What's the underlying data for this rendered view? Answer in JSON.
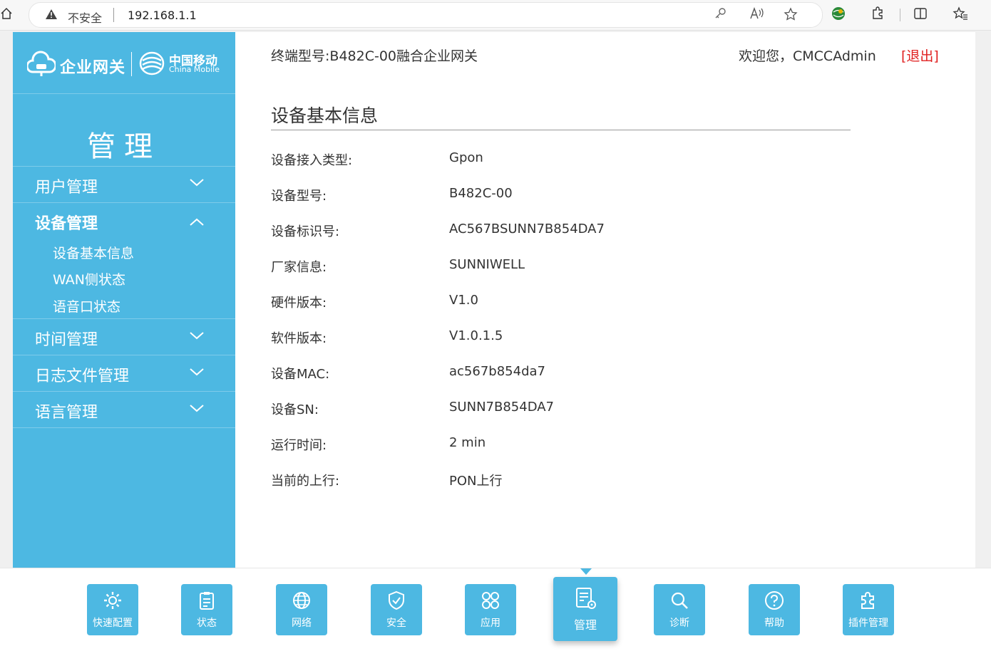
{
  "browser": {
    "insecure_label": "不安全",
    "url": "192.168.1.1"
  },
  "sidebar": {
    "logo_text": "企业网关",
    "brand_cn": "中国移动",
    "brand_en": "China Mobile",
    "title": "管理",
    "menu": [
      {
        "label": "用户管理"
      },
      {
        "label": "设备管理",
        "subitems": [
          "设备基本信息",
          "WAN侧状态",
          "语音口状态"
        ]
      },
      {
        "label": "时间管理"
      },
      {
        "label": "日志文件管理"
      },
      {
        "label": "语言管理"
      }
    ]
  },
  "header": {
    "terminal_label": "终端型号:",
    "terminal_model": "B482C-00融合企业网关",
    "welcome": "欢迎您，CMCCAdmin",
    "logout": "[退出]"
  },
  "section": {
    "title": "设备基本信息",
    "rows": [
      {
        "label": "设备接入类型:",
        "value": "Gpon"
      },
      {
        "label": "设备型号:",
        "value": "B482C-00"
      },
      {
        "label": "设备标识号:",
        "value": "AC567BSUNN7B854DA7"
      },
      {
        "label": "厂家信息:",
        "value": "SUNNIWELL"
      },
      {
        "label": "硬件版本:",
        "value": "V1.0"
      },
      {
        "label": "软件版本:",
        "value": "V1.0.1.5"
      },
      {
        "label": "设备MAC:",
        "value": "ac567b854da7"
      },
      {
        "label": "设备SN:",
        "value": "SUNN7B854DA7"
      },
      {
        "label": "运行时间:",
        "value": "2 min"
      },
      {
        "label": "当前的上行:",
        "value": "PON上行"
      }
    ]
  },
  "bottom_nav": [
    {
      "label": "快速配置",
      "icon": "gear-icon"
    },
    {
      "label": "状态",
      "icon": "clipboard-icon"
    },
    {
      "label": "网络",
      "icon": "globe-icon"
    },
    {
      "label": "安全",
      "icon": "shield-icon"
    },
    {
      "label": "应用",
      "icon": "apps-icon"
    },
    {
      "label": "管理",
      "icon": "manage-icon",
      "active": true
    },
    {
      "label": "诊断",
      "icon": "search-icon"
    },
    {
      "label": "帮助",
      "icon": "help-icon"
    },
    {
      "label": "插件管理",
      "icon": "puzzle-icon"
    }
  ],
  "colors": {
    "accent": "#4db8e2",
    "logout": "#e02020"
  }
}
